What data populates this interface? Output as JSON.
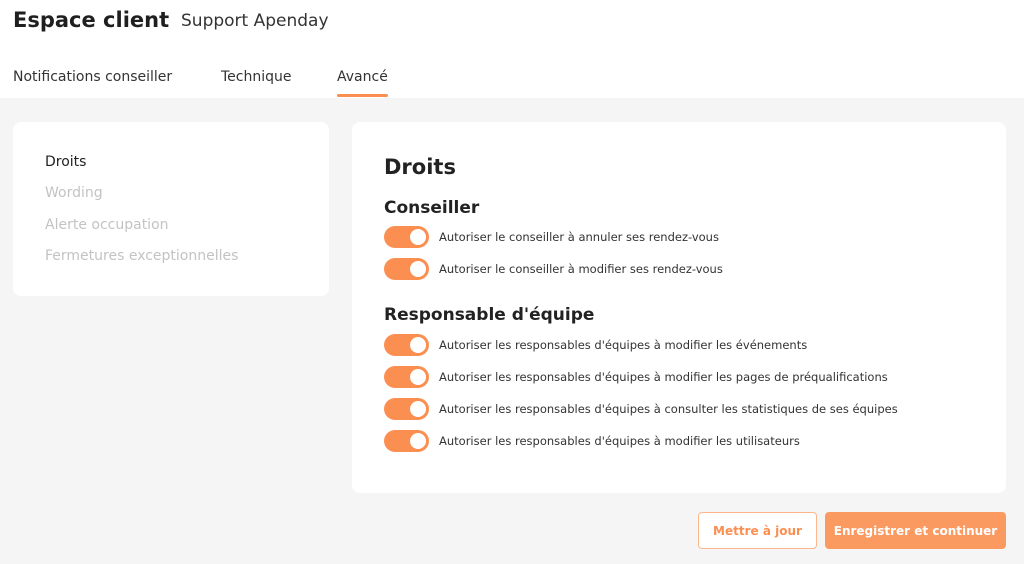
{
  "header": {
    "title": "Espace client",
    "subtitle": "Support Apenday",
    "tabs": [
      {
        "label": "Notifications conseiller"
      },
      {
        "label": "Technique"
      },
      {
        "label": "Avancé",
        "active": true
      }
    ]
  },
  "sidebar": {
    "items": [
      {
        "label": "Droits",
        "active": true
      },
      {
        "label": "Wording"
      },
      {
        "label": "Alerte occupation"
      },
      {
        "label": "Fermetures exceptionnelles"
      }
    ]
  },
  "main": {
    "title": "Droits",
    "sections": [
      {
        "title": "Conseiller",
        "toggles": [
          {
            "label": "Autoriser le conseiller à annuler ses rendez-vous",
            "on": true
          },
          {
            "label": "Autoriser le conseiller à modifier ses rendez-vous",
            "on": true
          }
        ]
      },
      {
        "title": "Responsable d'équipe",
        "toggles": [
          {
            "label": "Autoriser les responsables d'équipes à modifier les événements",
            "on": true
          },
          {
            "label": "Autoriser les responsables d'équipes à modifier les pages de préqualifications",
            "on": true
          },
          {
            "label": "Autoriser les responsables d'équipes à consulter les statistiques de ses équipes",
            "on": true
          },
          {
            "label": "Autoriser les responsables d'équipes à modifier les utilisateurs",
            "on": true
          }
        ]
      }
    ]
  },
  "actions": {
    "update_label": "Mettre à jour",
    "save_label": "Enregistrer et continuer"
  },
  "colors": {
    "accent": "#fb8f52",
    "inactive_text": "#c3c3c3"
  }
}
